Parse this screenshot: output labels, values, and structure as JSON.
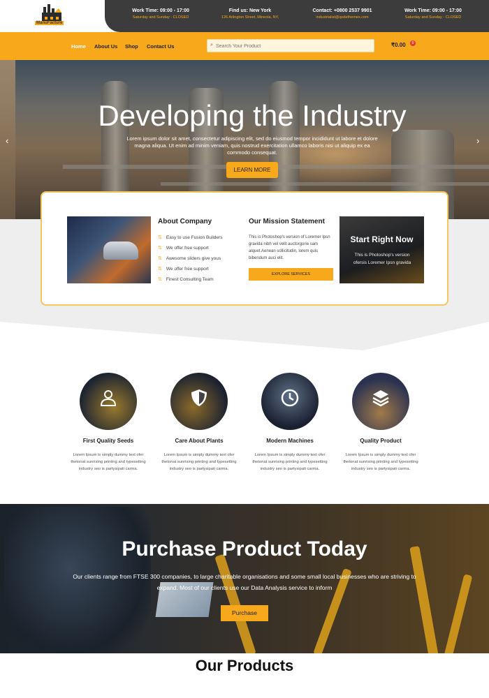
{
  "header": {
    "logo_text": "ManuFacture",
    "info": [
      {
        "line1": "Work Time: 09:00 - 17:00",
        "line2": "Saturday and Sunday - CLOSED"
      },
      {
        "line1": "Find us: New York",
        "line2": "126 Arlington Street, Mineola, NY,"
      },
      {
        "line1": "Contact: +0800 2537 9901",
        "line2": "industrialist@qodethemes.com"
      },
      {
        "line1": "Work Time: 09:00 - 17:00",
        "line2": "Saturday and Sunday - CLOSED"
      }
    ]
  },
  "nav": {
    "items": [
      "Home",
      "About Us",
      "Shop",
      "Contact Us"
    ],
    "search_placeholder": "Search Your Product",
    "cart_total": "₹0.00",
    "cart_count": "0",
    "accent": "#f7a91b"
  },
  "hero": {
    "title": "Developing the Industry",
    "text": "Lorem ipsum dolor sit amet, consectetur adipiscing elit, sed do eiusmod tempor incididunt ut labore et dolore magna aliqua. Ut enim ad minim veniam, quis nostrud exercitation ullamco laboris nisi ut aliquip ex ea commodo consequat.",
    "button": "LEARN MORE",
    "prev_arrow": "‹",
    "next_arrow": "›"
  },
  "card": {
    "about_title": "About Company",
    "features": [
      "Easy to use Fusion Builders",
      "We offer free support",
      "Awesome sliders give yous",
      "We offer free support",
      "Finest Consulting Team"
    ],
    "mission_title": "Our Mission Statement",
    "mission_text": "This is Photoshop's version of Loremer Ipsn gravida nibh vel velit auctorgorie sam alquet.Aenean sollicitudin, lorem quis bibendum auci elit.",
    "explore_button": "EXPLORE SERVICES",
    "start_title": "Start Right Now",
    "start_text": "This is Photoshop's version ofersis Loremer Ipsn gravida"
  },
  "features": [
    {
      "title": "First Quality Seeds",
      "text": "Lorem Ipsum is simply dummy text ofer thetonat sunrising printing and typesetting industry seo is partysipati carma.",
      "icon": "user-icon"
    },
    {
      "title": "Care About Plants",
      "text": "Lorem Ipsum is simply dummy text ofer thetonat sunrising printing and typesetting industry seo is partysipati carma.",
      "icon": "shield-icon"
    },
    {
      "title": "Modern Machines",
      "text": "Lorem Ipsum is simply dummy text ofer thetonat sunrising printing and typesetting industry seo is partysipati carma.",
      "icon": "clock-icon"
    },
    {
      "title": "Quality Product",
      "text": "Lorem Ipsum is simply dummy text ofer thetonat sunrising printing and typesetting industry seo is partysipati carma.",
      "icon": "layers-icon"
    }
  ],
  "purchase": {
    "title": "Purchase Product Today",
    "text": "Our clients range from FTSE 300 companies, to large charitable organisations and some small local businesses who are striving to expand. Most of our clients use our Data Analysis service to inform",
    "button": "Purchase"
  },
  "products": {
    "title": "Our Products"
  }
}
